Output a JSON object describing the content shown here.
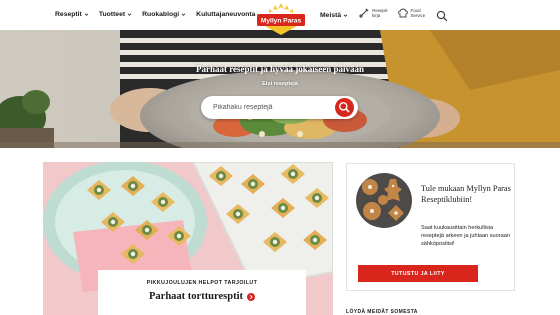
{
  "header": {
    "nav_left": [
      "Reseptit",
      "Tuotteet",
      "Ruokablogi",
      "Kuluttajaneuvonta"
    ],
    "logo_text": "Myllyn Paras",
    "nav_right": "Meistä",
    "tools": [
      {
        "label_line1": "Resepti-",
        "label_line2": "kirja",
        "icon": "recipe-book-icon"
      },
      {
        "label_line1": "Food",
        "label_line2": "Service",
        "icon": "chef-hat-icon"
      }
    ],
    "search_icon": "search-icon"
  },
  "hero": {
    "title": "Parhaat reseptit ja hyvää jokaiseen päivään",
    "subtitle": "Etsi reseptejä",
    "search_placeholder": "Pikahaku reseptejä"
  },
  "feature_card": {
    "kicker": "PIKKUJOULUJEN HELPOT TARJOILUT",
    "title": "Parhaat tortturesptit"
  },
  "club": {
    "title": "Tule mukaan Myllyn Paras Reseptiklubiin!",
    "text": "Saat kuukausittain herkullisia reseptejä arkeen ja juhlaan suoraan sähköpostiisi!",
    "button": "TUTUSTU JA LIITY"
  },
  "bottom_label": "LÖYDÄ MEIDÄT SOMESTA",
  "colors": {
    "accent": "#d9261c",
    "logo_bg": "#d9261c",
    "logo_gold": "#f4c52b"
  }
}
